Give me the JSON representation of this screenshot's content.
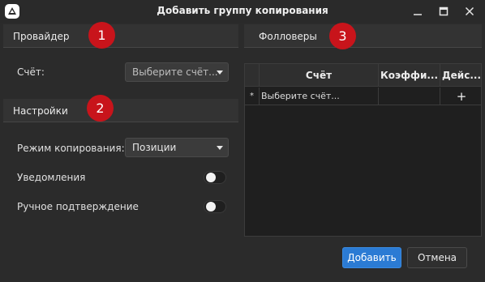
{
  "window": {
    "title": "Добавить группу копирования"
  },
  "provider": {
    "header": "Провайдер",
    "badge": "1",
    "account_label": "Счёт:",
    "account_select": "Выберите счёт..."
  },
  "settings": {
    "header": "Настройки",
    "badge": "2",
    "copy_mode_label": "Режим копирования:",
    "copy_mode_value": "Позиции",
    "notifications_label": "Уведомления",
    "notifications_on": false,
    "manual_confirm_label": "Ручное подтверждение",
    "manual_confirm_on": false
  },
  "followers": {
    "header": "Фолловеры",
    "badge": "3",
    "columns": [
      "Счёт",
      "Коэффи...",
      "Дейс..."
    ],
    "new_row": {
      "marker": "*",
      "account": "Выберите счёт...",
      "action": "+"
    }
  },
  "footer": {
    "add_label": "Добавить",
    "cancel_label": "Отмена"
  },
  "colors": {
    "accent": "#2b7bd4",
    "badge": "#c8141b",
    "background": "#2b2b2b"
  }
}
